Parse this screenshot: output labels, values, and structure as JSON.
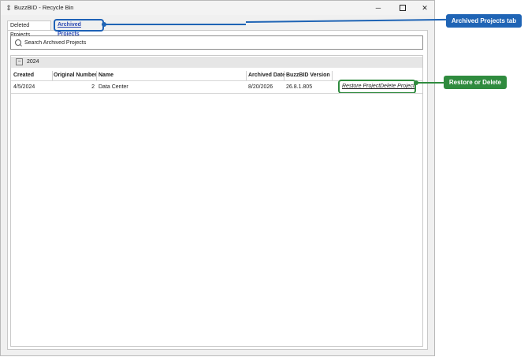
{
  "window": {
    "title": "BuzzBID - Recycle Bin",
    "minimize_glyph": "─",
    "close_glyph": "✕"
  },
  "tabs": [
    {
      "label": "Deleted Projects",
      "selected": false
    },
    {
      "label": "Archived Projects",
      "selected": true
    }
  ],
  "search": {
    "placeholder": "Search Archived Projects",
    "value": ""
  },
  "group": {
    "toggle": "⊟",
    "label": "2024"
  },
  "columns": [
    "Created",
    "Original Number",
    "Name",
    "Archived Date",
    "BuzzBID Version"
  ],
  "rows": [
    {
      "created": "4/5/2024",
      "original_number": "2",
      "name": "Data Center",
      "archived_date": "8/20/2026",
      "version": "26.8.1.805",
      "restore_label": "Restore Project",
      "delete_label": "Delete Project"
    }
  ],
  "callouts": {
    "archived_tab": "Archived Projects tab",
    "restore_delete": "Restore or Delete"
  },
  "colors": {
    "callout_blue": "#1f64b5",
    "callout_green": "#2f8b3e",
    "active_tab_text": "#2b49b3"
  }
}
